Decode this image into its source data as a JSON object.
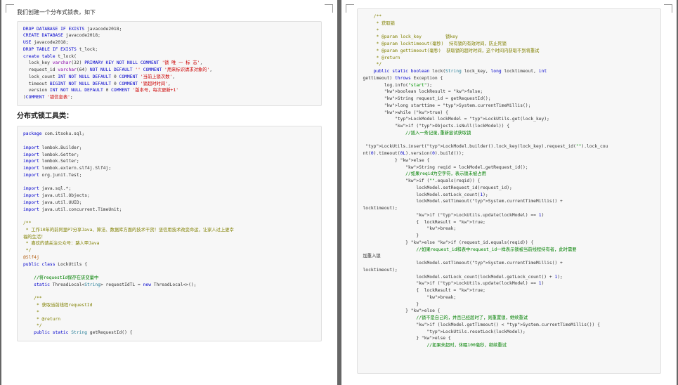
{
  "intro": "我们创建一个分布式锁表，如下",
  "sql_block": [
    "DROP DATABASE IF EXISTS javacode2018;",
    "CREATE DATABASE javacode2018;",
    "USE javacode2018;",
    "DROP TABLE IF EXISTS t_lock;",
    "create table t_lock(",
    "  lock_key varchar(32) PRIMARY KEY NOT NULL COMMENT '锁 唯 一 标 志',",
    "  request_id varchar(64) NOT NULL DEFAULT '' COMMENT '用来标识请求对象的',",
    "  lock_count INT NOT NULL DEFAULT 0 COMMENT '当前上锁次数',",
    "  timeout BIGINT NOT NULL DEFAULT 0 COMMENT '锁超时时间',",
    "  version INT NOT NULL DEFAULT 0 COMMENT '版本号，每次更新+1'",
    ")COMMENT '锁信息表';"
  ],
  "section1_title": "分布式锁工具类：",
  "left_code": {
    "pkg": "package com.itsoku.sql;",
    "imports": [
      "import lombok.Builder;",
      "import lombok.Getter;",
      "import lombok.Setter;",
      "import lombok.extern.slf4j.Slf4j;",
      "import org.junit.Test;",
      "",
      "import java.sql.*;",
      "import java.util.Objects;",
      "import java.util.UUID;",
      "import java.util.concurrent.TimeUnit;"
    ],
    "doc1": [
      "/**",
      " * 工作10年的前阿里P7分享Java、算法、数据库方面的技术干货！坚信用技术改变命运，让家人过上更幸",
      "福的生活！",
      " * 喜欢的请关注公众号：路人甲Java",
      " */"
    ],
    "ann": "@Slf4j",
    "cls": "public class LockUtils {",
    "innercom": "    //将requestId保存在该变量中",
    "innerline": "    static ThreadLocal<String> requestIdTL = new ThreadLocal<>();",
    "doc2": [
      "    /**",
      "     * 获取当前线程requestId",
      "     *",
      "     * @return",
      "     */"
    ],
    "m1": "    public static String getRequestId() {"
  },
  "right_code": {
    "doc": [
      "    /**",
      "     * 获取锁",
      "     *",
      "     * @param lock_key         锁key",
      "     * @param locktimeout(毫秒)  持有锁的有效时间，防止死锁",
      "     * @param gettimeout(毫秒)  获取锁的超时时间，这个时间内获取不到将重试",
      "     * @return",
      "     */"
    ],
    "sig": "    public static boolean lock(String lock_key, long locktimeout, int",
    "sig2": "gettimeout) throws Exception {",
    "lines": [
      "        log.info(\"start\");",
      "        boolean lockResult = false;",
      "        String request_id = getRequestId();",
      "        long starttime = System.currentTimeMillis();",
      "        while (true) {",
      "            LockModel lockModel = LockUtils.get(lock_key);",
      "            if (Objects.isNull(lockModel)) {",
      "                //插入一条记录,重新尝试获取锁",
      "",
      " LockUtils.insert(LockModel.builder().lock_key(lock_key).request_id(\"\").lock_cou",
      "nt(0).timeout(0L).version(0).build());",
      "            } else {",
      "                String reqid = lockModel.getRequest_id();",
      "                //如果reqid为空字符，表示锁未被占用",
      "                if (\"\".equals(reqid)) {",
      "                    lockModel.setRequest_id(request_id);",
      "                    lockModel.setLock_count(1);",
      "                    lockModel.setTimeout(System.currentTimeMillis() +",
      "locktimeout);",
      "                    if (LockUtils.update(lockModel) == 1)",
      "                    {  lockResult = true;",
      "                        break;",
      "                    }",
      "                } else if (request_id.equals(reqid)) {",
      "                    //如果request_id和表中request_id一样表示锁被当前线程持有者，此时需要",
      "加重入锁",
      "                    lockModel.setTimeout(System.currentTimeMillis() +",
      "locktimeout);",
      "                    lockModel.setLock_count(lockModel.getLock_count() + 1);",
      "                    if (LockUtils.update(lockModel) == 1)",
      "                    {  lockResult = true;",
      "                        break;",
      "                    }",
      "                } else {",
      "                    //锁不是自己的，并且已经超时了，则重置锁，继续重试",
      "                    if (lockModel.getTimeout() < System.currentTimeMillis()) {",
      "                        LockUtils.resetLock(lockModel);",
      "                    } else {",
      "                        //如果未超时，休眠100毫秒，继续重试"
    ]
  }
}
